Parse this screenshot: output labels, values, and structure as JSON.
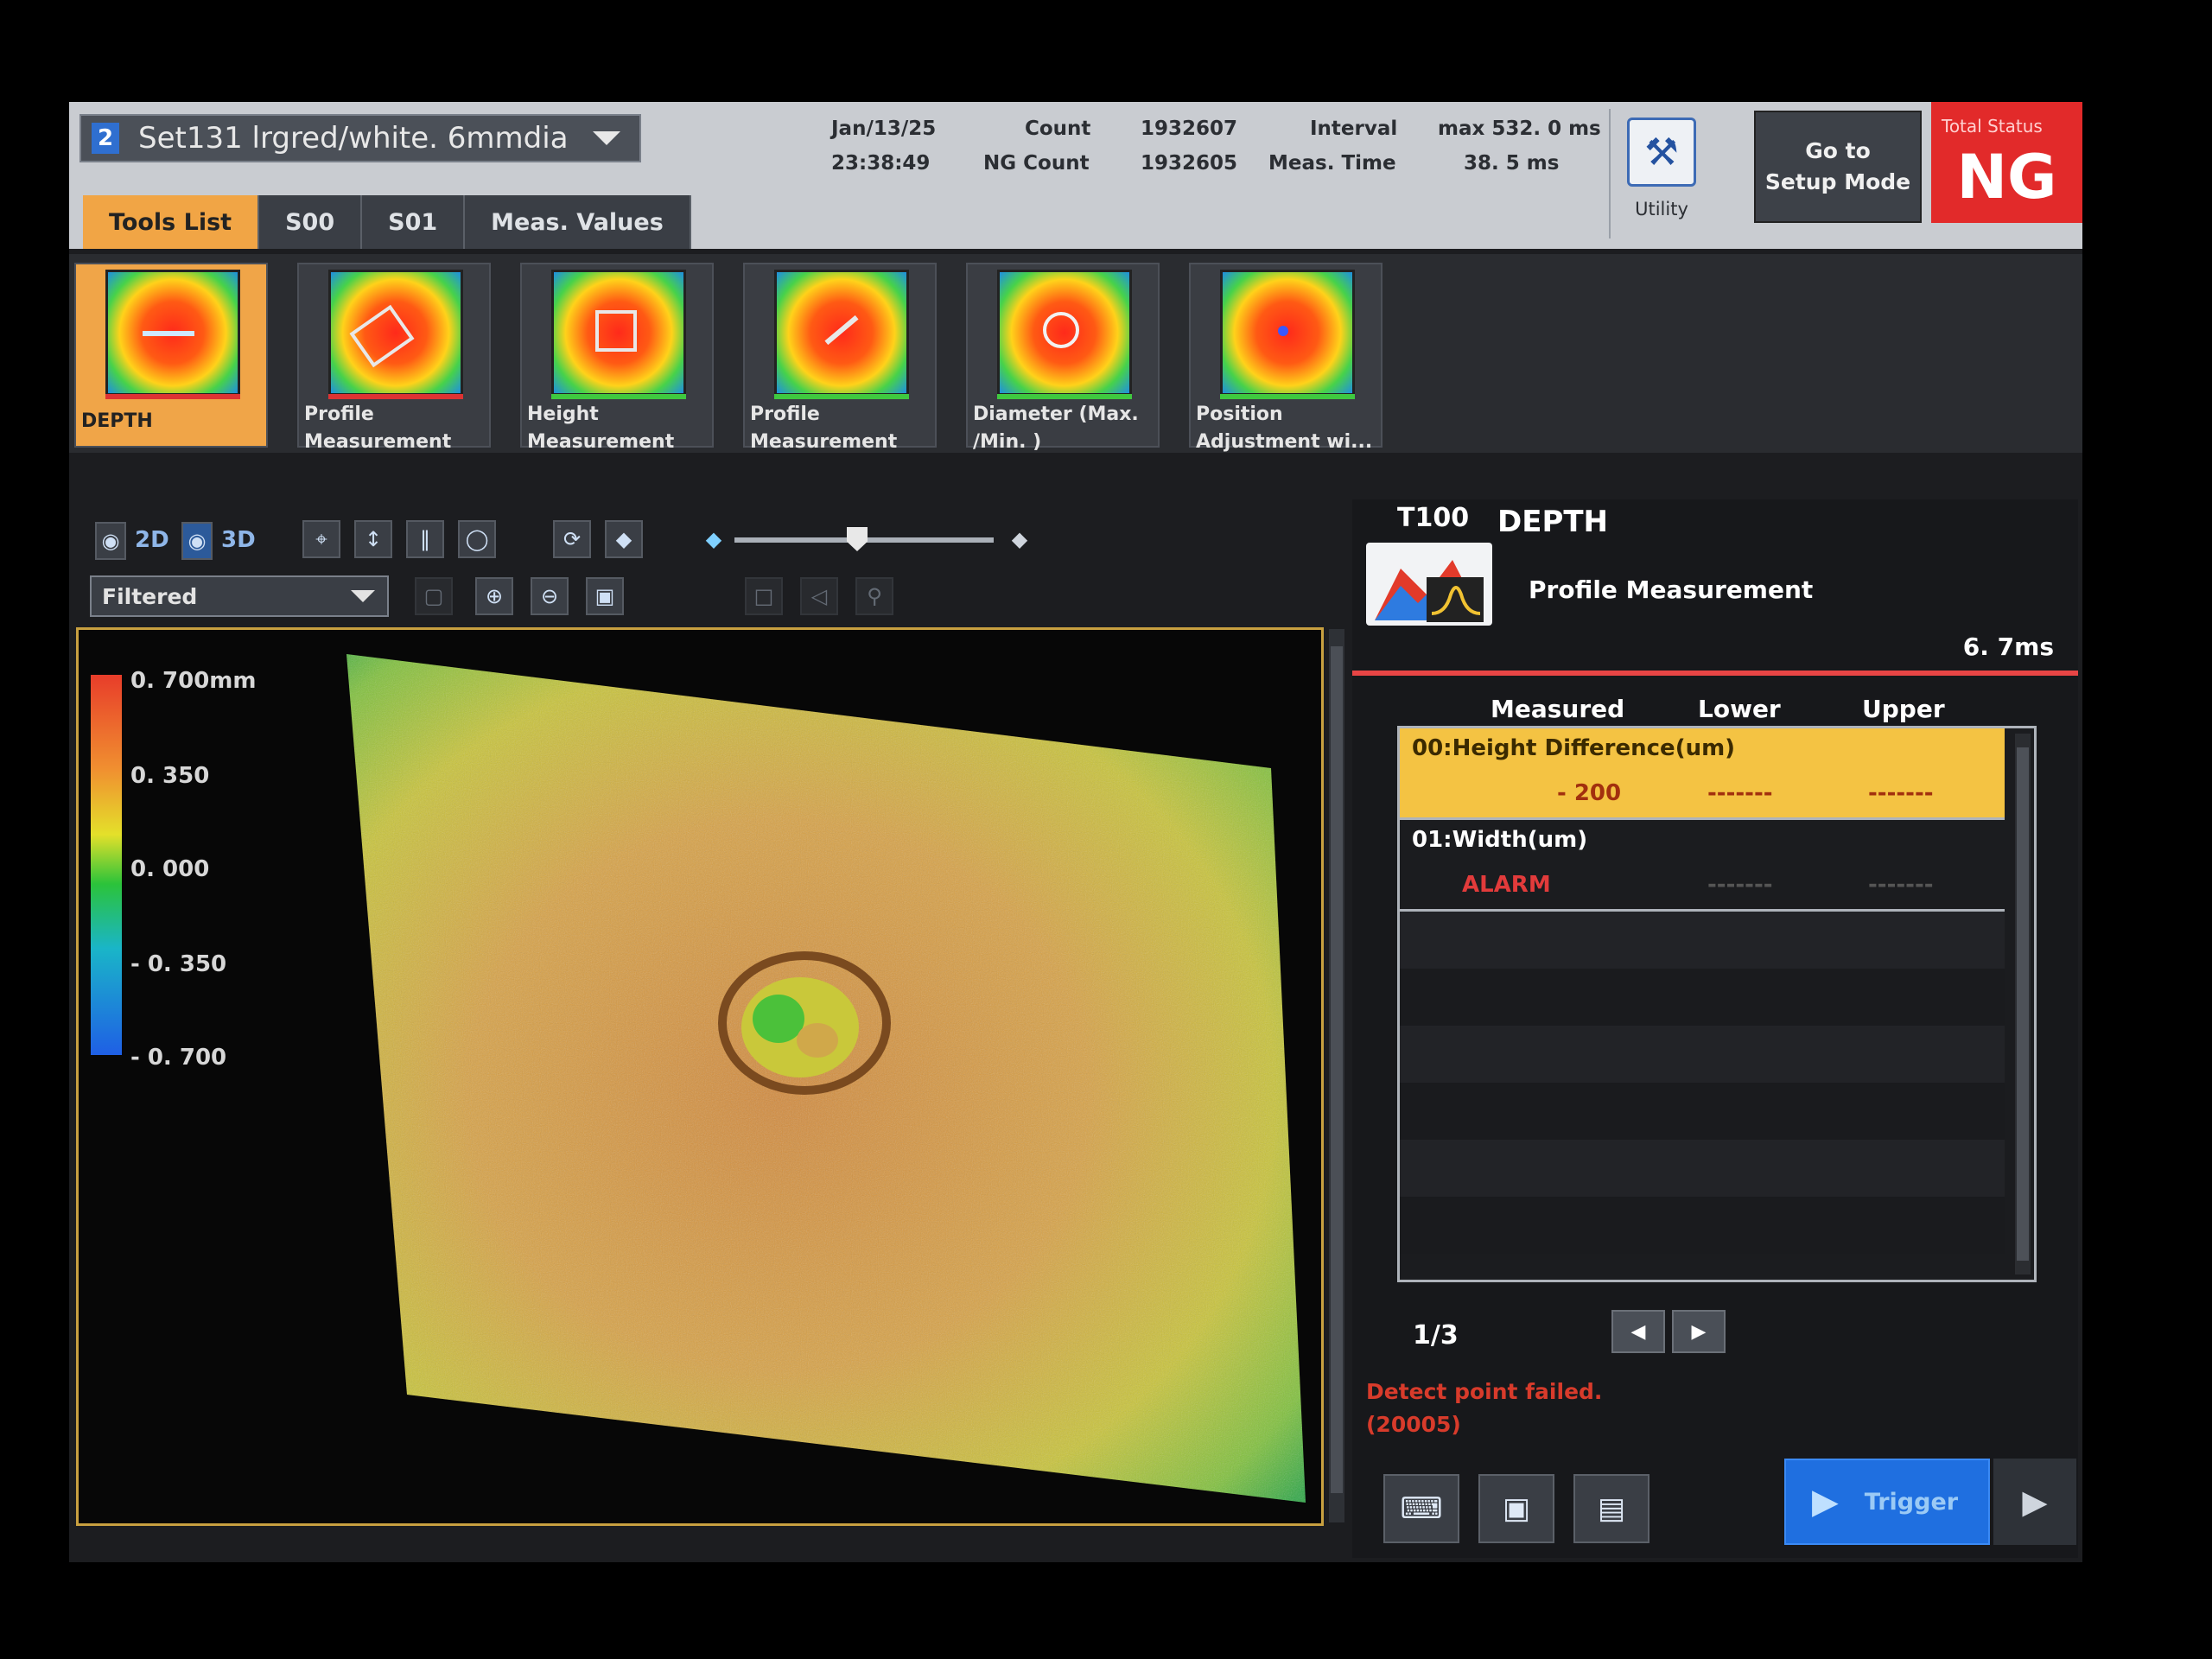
{
  "header": {
    "set_number": "2",
    "set_name": "Set131  lrgred/white. 6mmdia",
    "date": "Jan/13/25",
    "time": "23:38:49",
    "count_label": "Count",
    "count_value": "1932607",
    "ng_count_label": "NG  Count",
    "ng_count_value": "1932605",
    "interval_label": "Interval",
    "interval_value": "max  532. 0  ms",
    "meas_time_label": "Meas. Time",
    "meas_time_value": "38. 5  ms",
    "utility_label": "Utility",
    "setup_button_line1": "Go  to",
    "setup_button_line2": "Setup  Mode",
    "total_status_label": "Total  Status",
    "total_status_value": "NG",
    "tabs": [
      "Tools  List",
      "S00",
      "S01",
      "Meas. Values"
    ]
  },
  "tools": [
    {
      "line1": "DEPTH",
      "line2": ""
    },
    {
      "line1": "Profile",
      "line2": "Measurement"
    },
    {
      "line1": "Height",
      "line2": "Measurement"
    },
    {
      "line1": "Profile",
      "line2": "Measurement"
    },
    {
      "line1": "Diameter  (Max.",
      "line2": "/Min. )"
    },
    {
      "line1": "Position",
      "line2": "Adjustment  wi..."
    }
  ],
  "toolbar": {
    "view_2d": "2D",
    "view_3d": "3D",
    "filter_value": "Filtered"
  },
  "scale": [
    "0. 700mm",
    "0. 350",
    "0. 000",
    "- 0. 350",
    "- 0. 700"
  ],
  "panel": {
    "tool_id": "T100",
    "tool_name": "DEPTH",
    "tool_type": "Profile  Measurement",
    "tool_time": "6. 7ms",
    "col_measured": "Measured",
    "col_lower": "Lower",
    "col_upper": "Upper",
    "rows": [
      {
        "name": "00:Height  Difference(um)",
        "measured": "- 200",
        "lower": "-------",
        "upper": "-------"
      },
      {
        "name": "01:Width(um)",
        "measured": "ALARM",
        "lower": "-------",
        "upper": "-------"
      }
    ],
    "page": "1/3",
    "error_line1": "Detect  point  failed.",
    "error_line2": "(20005)",
    "trigger_label": "Trigger"
  },
  "colors": {
    "ng_red": "#e22a2a",
    "accent_orange": "#f0a548",
    "highlight_yellow": "#f4c343",
    "trigger_blue": "#1f6fe0"
  }
}
